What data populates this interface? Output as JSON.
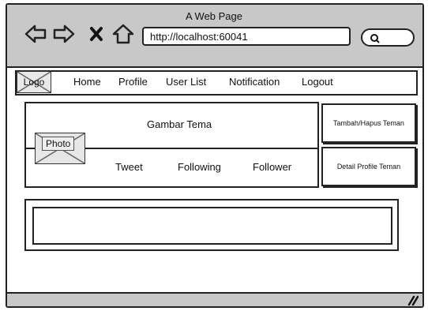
{
  "window": {
    "title": "A Web Page"
  },
  "browser": {
    "url": "http://localhost:60041"
  },
  "menu": {
    "logo": "Logo",
    "items": [
      "Home",
      "Profile",
      "User List",
      "Notification",
      "Logout"
    ]
  },
  "profile": {
    "photo_label": "Photo",
    "banner_label": "Gambar Tema",
    "stats": [
      "Tweet",
      "Following",
      "Follower"
    ]
  },
  "actions": {
    "add_remove": "Tambah/Hapus Teman",
    "detail": "Detail Profile Teman"
  }
}
